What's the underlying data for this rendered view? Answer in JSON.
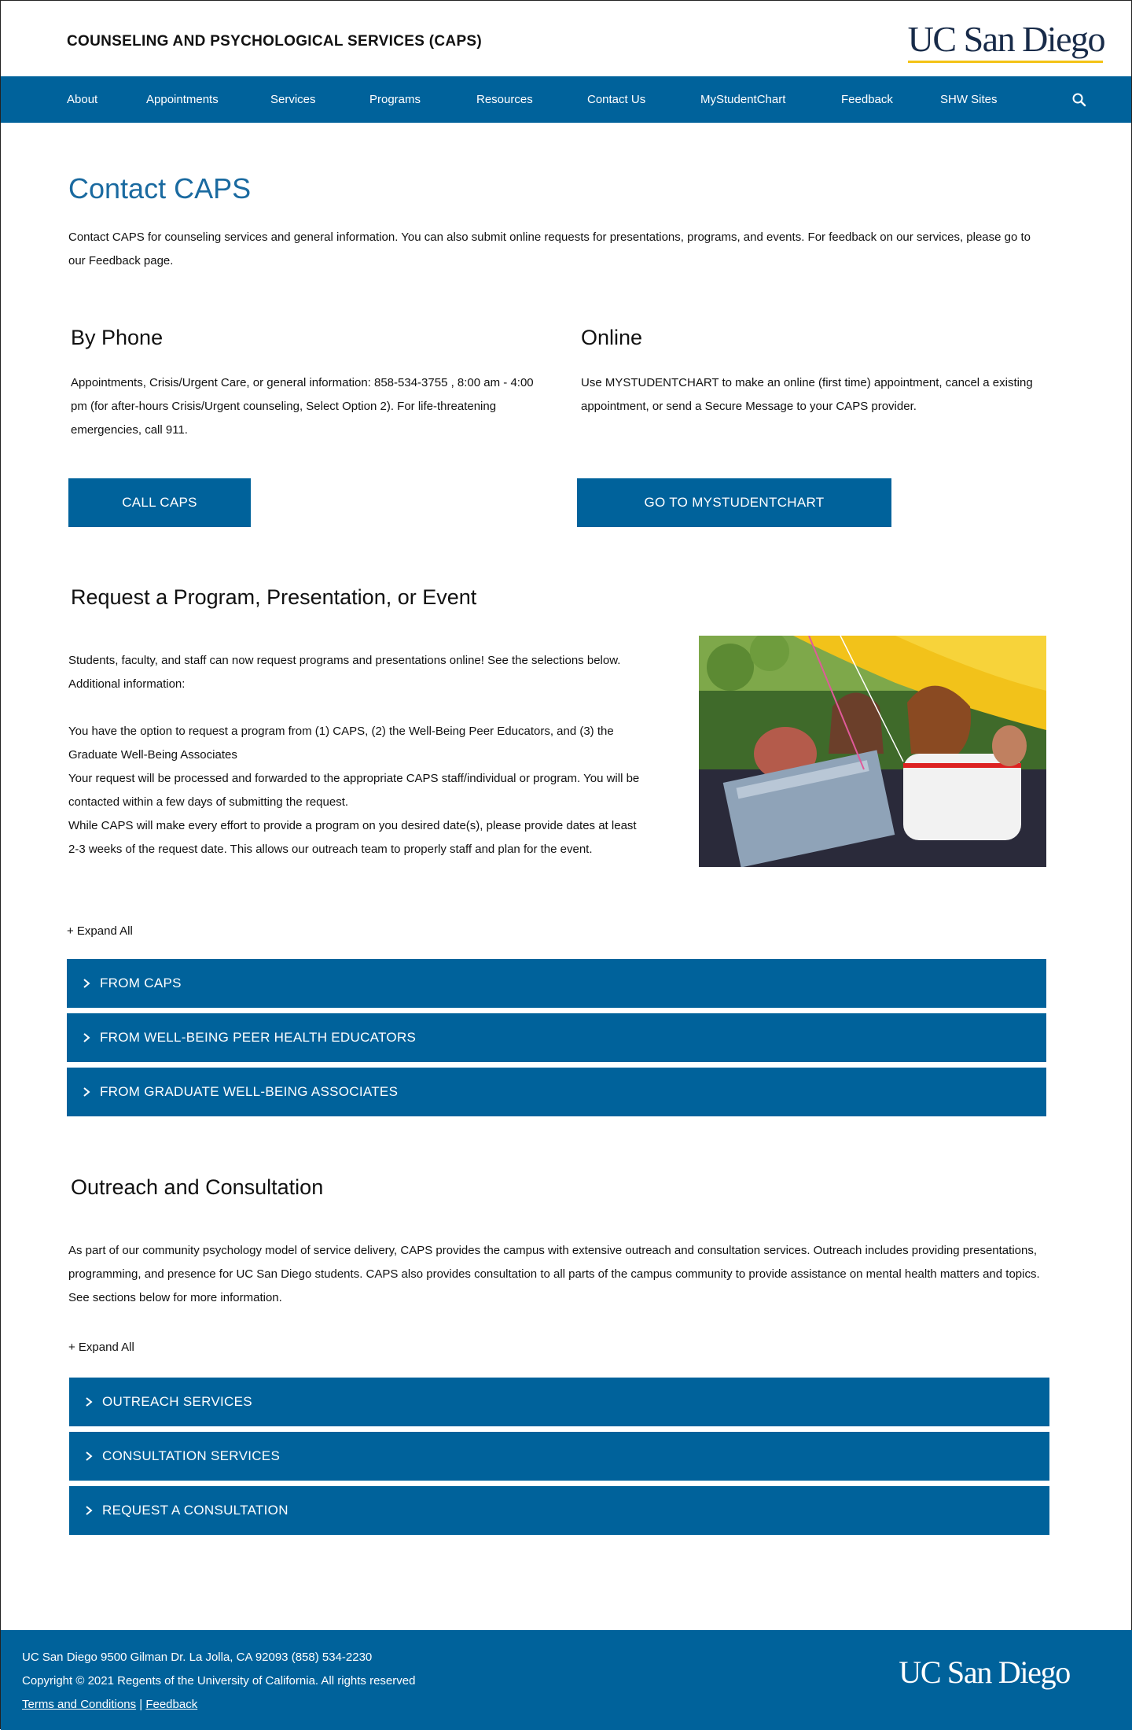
{
  "header": {
    "site_title": "COUNSELING AND PSYCHOLOGICAL SERVICES (CAPS)",
    "logo_text": "UC San Diego"
  },
  "nav": {
    "items": [
      "About",
      "Appointments",
      "Services",
      "Programs",
      "Resources",
      "Contact Us",
      "MyStudentChart",
      "Feedback",
      "SHW Sites"
    ],
    "search_icon": "search-icon"
  },
  "page": {
    "title": "Contact CAPS",
    "intro": "Contact CAPS for counseling services and general information. You can also submit online requests for presentations, programs, and events. For feedback on our services, please go to our Feedback page."
  },
  "phone": {
    "heading": "By Phone",
    "text": "Appointments, Crisis/Urgent Care, or general information: 858-534-3755 , 8:00 am - 4:00 pm (for after-hours Crisis/Urgent counseling, Select Option 2). For life-threatening emergencies, call 911.",
    "button": "CALL CAPS"
  },
  "online": {
    "heading": "Online",
    "text": "Use MYSTUDENTCHART to make an online (first time) appointment, cancel a existing appointment, or send a Secure Message to your CAPS provider.",
    "button": "GO TO MYSTUDENTCHART"
  },
  "request": {
    "heading": "Request a Program, Presentation, or Event",
    "p1": "Students, faculty, and staff can now request programs and presentations online! See the selections below. Additional information:",
    "p2": "You have the option to request a program from (1) CAPS, (2) the Well-Being Peer Educators, and (3) the Graduate Well-Being Associates",
    "p3": "Your request will be processed and forwarded to the appropriate CAPS staff/individual or program. You will be contacted within a few days of submitting the request.",
    "p4": "While CAPS will make every effort to provide a program on you desired date(s), please provide dates at least 2-3 weeks of the request date. This allows our outreach team to properly staff and plan for the event.",
    "expand_all": "+ Expand All",
    "accordions": [
      "FROM CAPS",
      "FROM WELL-BEING PEER HEALTH EDUCATORS",
      "FROM GRADUATE WELL-BEING ASSOCIATES"
    ]
  },
  "outreach": {
    "heading": "Outreach and Consultation",
    "text": "As part of our community psychology model of service delivery, CAPS provides the campus with extensive outreach and consultation services. Outreach includes providing presentations, programming, and presence for UC San Diego students. CAPS also provides consultation to all parts of the campus community to provide assistance on mental health matters and topics. See sections below for more information.",
    "expand_all": "+ Expand All",
    "accordions": [
      "OUTREACH SERVICES",
      "CONSULTATION SERVICES",
      "REQUEST A CONSULTATION"
    ]
  },
  "footer": {
    "address": "UC San Diego 9500 Gilman Dr. La Jolla, CA 92093 (858) 534-2230",
    "copyright": "Copyright © 2021 Regents of the University of California. All rights reserved",
    "terms": "Terms and Conditions",
    "separator": "|",
    "feedback": "Feedback",
    "logo_text": "UC San Diego"
  },
  "colors": {
    "brand_blue": "#00629b",
    "title_blue": "#1a6aa0",
    "logo_navy": "#182b49",
    "logo_gold": "#f3c316"
  }
}
